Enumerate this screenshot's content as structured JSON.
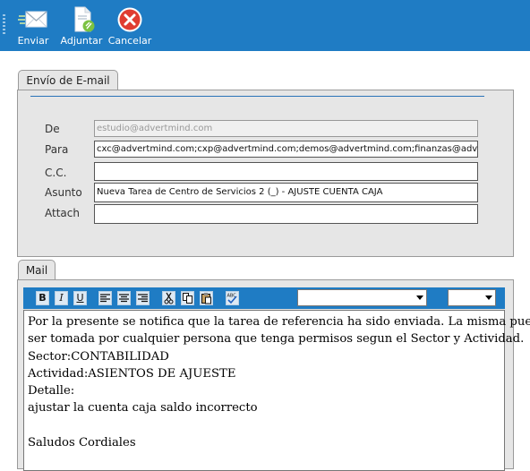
{
  "toolbar": {
    "send_label": "Enviar",
    "attach_label": "Adjuntar",
    "cancel_label": "Cancelar",
    "accent_color": "#1f7cc4"
  },
  "email_panel": {
    "tab_label": "Envío de E-mail",
    "labels": {
      "from": "De",
      "to": "Para",
      "cc": "C.C.",
      "subject": "Asunto",
      "attach": "Attach"
    },
    "from_value": "estudio@advertmind.com",
    "to_value": "cxc@advertmind.com;cxp@advertmind.com;demos@advertmind.com;finanzas@advertmind.com",
    "cc_value": "",
    "subject_value": "Nueva Tarea de Centro de Servicios 2 (_) - AJUSTE CUENTA CAJA",
    "attach_value": ""
  },
  "mail_panel": {
    "tab_label": "Mail",
    "editor_buttons": [
      "B",
      "I",
      "U"
    ],
    "body_lines": [
      "Por la presente se notifica que la tarea de referencia ha sido enviada. La misma puede",
      "ser tomada por cualquier persona que tenga permisos segun el Sector y Actividad.",
      "Sector:CONTABILIDAD",
      "Actividad:ASIENTOS DE AJUESTE",
      "Detalle:",
      "ajustar la cuenta caja saldo incorrecto",
      "",
      "Saludos Cordiales"
    ]
  }
}
